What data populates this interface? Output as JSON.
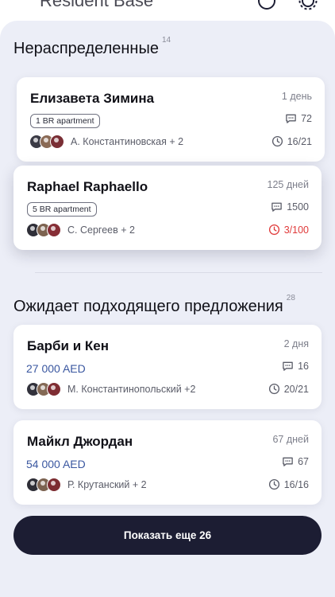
{
  "header": {
    "title": "Resident Base"
  },
  "colors": {
    "accent_dark": "#1c1d33",
    "price": "#3a57a0",
    "alert": "#e03a3a",
    "panel_bg": "#eceef7"
  },
  "sections": [
    {
      "title": "Нераспределенные",
      "count": "14",
      "cards": [
        {
          "name": "Елизавета Зимина",
          "age": "1 день",
          "tag": "1 BR apartment",
          "messages": "72",
          "agents": "А. Константиновская + 2",
          "time": "16/21",
          "overdue": false
        },
        {
          "name": "Raphael Raphaello",
          "age": "125 дней",
          "tag": "5 BR apartment",
          "messages": "1500",
          "agents": "С. Сергеев + 2",
          "time": "3/100",
          "overdue": true
        }
      ]
    },
    {
      "title": "Ожидает подходящего предложения",
      "count": "28",
      "cards": [
        {
          "name": "Барби и Кен",
          "age": "2 дня",
          "price": "27 000 AED",
          "messages": "16",
          "agents": "М. Константинопольский +2",
          "time": "20/21"
        },
        {
          "name": "Майкл Джордан",
          "age": "67 дней",
          "price": "54 000 AED",
          "messages": "67",
          "agents": "Р. Крутанский + 2",
          "time": "16/16"
        }
      ]
    }
  ],
  "show_more": {
    "label": "Показать еще 26"
  }
}
